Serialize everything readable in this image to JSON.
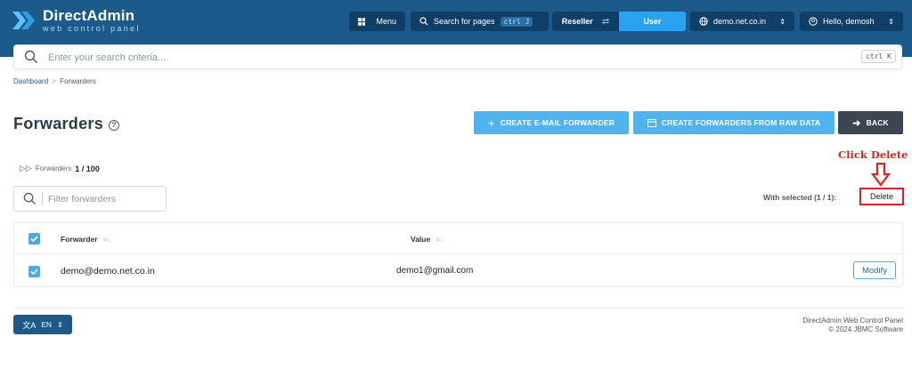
{
  "header": {
    "logo_title": "DirectAdmin",
    "logo_subtitle": "web control panel",
    "menu_label": "Menu",
    "search_pages_label": "Search for pages",
    "search_pages_shortcut": "ctrl J",
    "role_left": "Reseller",
    "role_right": "User",
    "domain_label": "demo.net.co.in",
    "user_label": "Hello, demosh",
    "colors": {
      "bar": "#1c5a8c",
      "button": "#0f3f66",
      "active": "#29a3ef"
    }
  },
  "search": {
    "placeholder": "Enter your search criteria...",
    "shortcut": "ctrl K"
  },
  "breadcrumb": {
    "home": "Dashboard",
    "separator": ">",
    "current": "Forwarders"
  },
  "page": {
    "title": "Forwarders"
  },
  "actions": {
    "create_forwarder": "CREATE E-MAIL FORWARDER",
    "create_raw": "CREATE FORWARDERS FROM RAW DATA",
    "back": "BACK"
  },
  "counter": {
    "label": "Forwarders",
    "value": "1 / 100"
  },
  "filter": {
    "placeholder": "Filter forwarders"
  },
  "selection": {
    "with_selected": "With selected (1 / 1):",
    "delete_label": "Delete"
  },
  "annotation": {
    "text": "Click Delete",
    "color": "#e02020"
  },
  "table": {
    "columns": [
      "Forwarder",
      "Value"
    ],
    "rows": [
      {
        "forwarder": "demo@demo.net.co.in",
        "value": "demo1@gmail.com",
        "action": "Modify"
      }
    ]
  },
  "footer": {
    "language": "EN",
    "line1": "DirectAdmin Web Control Panel",
    "line2": "© 2024 JBMC Software"
  }
}
